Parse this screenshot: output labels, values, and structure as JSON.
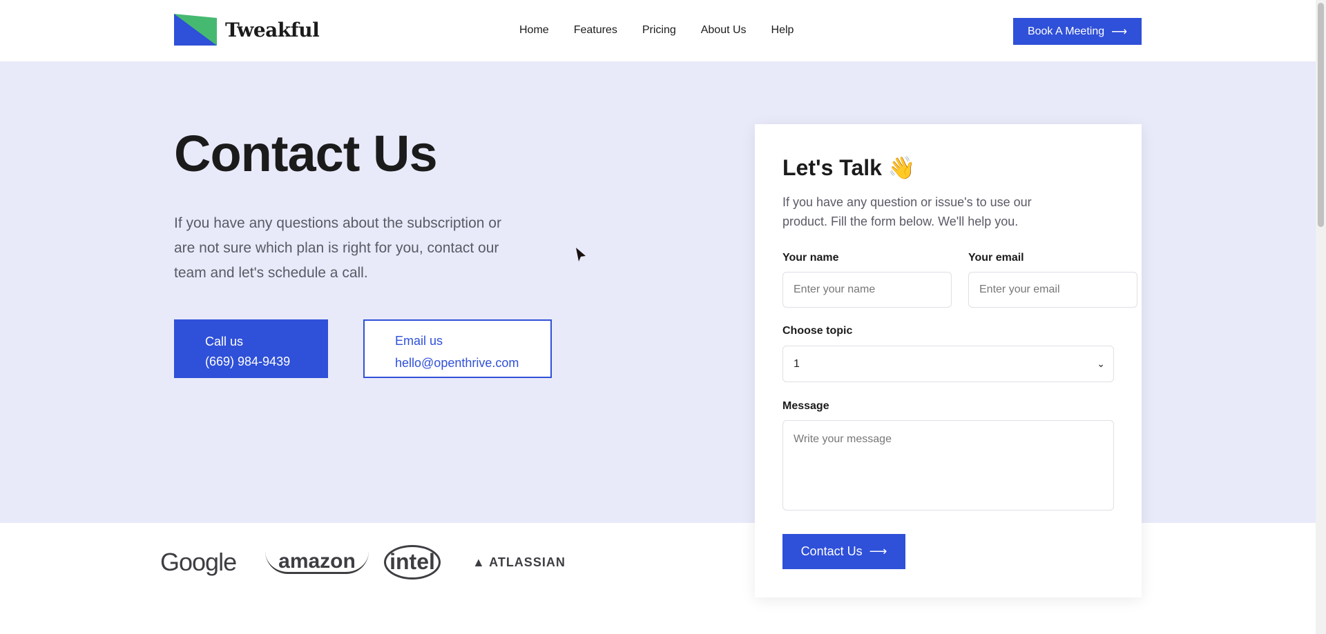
{
  "brand": {
    "name": "Tweakful",
    "colors": {
      "blue": "#2f50d8",
      "green": "#46b970",
      "hero_bg": "#e8eafa"
    }
  },
  "nav": {
    "items": [
      "Home",
      "Features",
      "Pricing",
      "About Us",
      "Help"
    ],
    "cta": "Book A Meeting"
  },
  "hero": {
    "title": "Contact Us",
    "lead": "If you have any questions about the subscription or are not sure which plan is right for you, contact our team and let's schedule a call.",
    "call": {
      "label": "Call us",
      "value": "(669) 984-9439"
    },
    "email": {
      "label": "Email us",
      "value": "hello@openthrive.com"
    }
  },
  "form": {
    "title": "Let's Talk 👋",
    "description": "If you have any question or issue's to use our product. Fill the form below. We'll help you.",
    "name_label": "Your name",
    "name_placeholder": "Enter your name",
    "email_label": "Your email",
    "email_placeholder": "Enter your email",
    "topic_label": "Choose topic",
    "topic_value": "1",
    "message_label": "Message",
    "message_placeholder": "Write your message",
    "submit": "Contact Us"
  },
  "partners": [
    "Google",
    "amazon",
    "intel",
    "ATLASSIAN"
  ]
}
